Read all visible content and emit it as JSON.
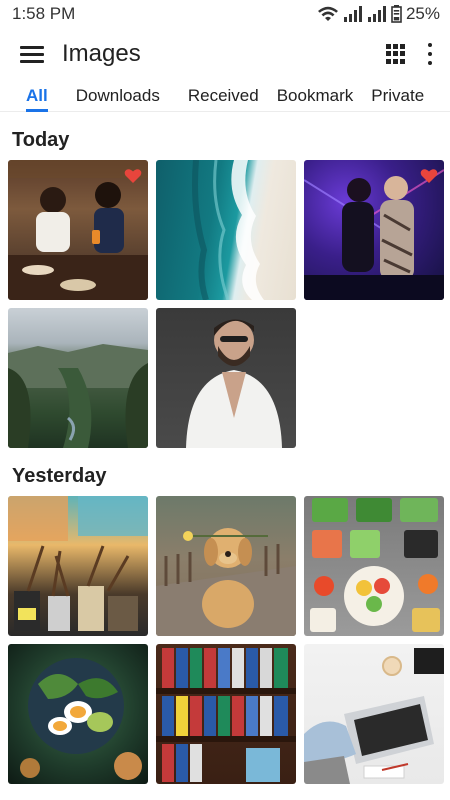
{
  "status_bar": {
    "time": "1:58 PM",
    "battery": "25%"
  },
  "app_bar": {
    "title": "Images"
  },
  "tabs": [
    {
      "label": "All",
      "active": true
    },
    {
      "label": "Downloads",
      "active": false
    },
    {
      "label": "Received",
      "active": false
    },
    {
      "label": "Bookmark",
      "active": false
    },
    {
      "label": "Private",
      "active": false
    }
  ],
  "sections": [
    {
      "title": "Today",
      "images": [
        {
          "subject": "friends dining",
          "favorite": true
        },
        {
          "subject": "aerial ocean shore",
          "favorite": false
        },
        {
          "subject": "party dancers",
          "favorite": true
        },
        {
          "subject": "green canyon",
          "favorite": false
        },
        {
          "subject": "bearded man",
          "favorite": false
        }
      ]
    },
    {
      "title": "Yesterday",
      "images": [
        {
          "subject": "art supplies",
          "favorite": false
        },
        {
          "subject": "dog with flower",
          "favorite": false
        },
        {
          "subject": "vegetable bowls",
          "favorite": false
        },
        {
          "subject": "eggs and avocado",
          "favorite": false
        },
        {
          "subject": "bookshelf binders",
          "favorite": false
        },
        {
          "subject": "laptop desk",
          "favorite": false
        }
      ]
    }
  ],
  "colors": {
    "accent": "#1a73e8",
    "favorite": "#e8453c"
  }
}
